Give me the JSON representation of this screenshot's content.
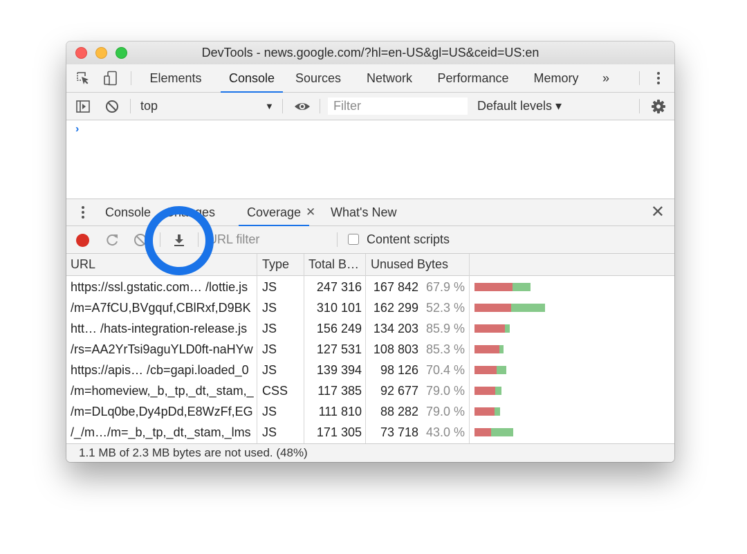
{
  "window": {
    "title": "DevTools - news.google.com/?hl=en-US&gl=US&ceid=US:en"
  },
  "main_tabs": [
    {
      "label": "Elements"
    },
    {
      "label": "Console",
      "active": true
    },
    {
      "label": "Sources"
    },
    {
      "label": "Network"
    },
    {
      "label": "Performance"
    },
    {
      "label": "Memory"
    }
  ],
  "main_tabs_overflow": "»",
  "console_toolbar": {
    "context": "top",
    "filter_placeholder": "Filter",
    "levels": "Default levels ▾"
  },
  "console": {
    "prompt": "›"
  },
  "drawer_tabs": [
    {
      "label": "Console"
    },
    {
      "label": "Changes"
    },
    {
      "label": "Coverage",
      "active": true,
      "closable": true
    },
    {
      "label": "What's New"
    }
  ],
  "coverage_toolbar": {
    "url_filter_placeholder": "URL filter",
    "content_scripts_label": "Content scripts",
    "content_scripts_checked": false,
    "export_button_highlighted": true
  },
  "coverage_table": {
    "columns": [
      "URL",
      "Type",
      "Total B…",
      "Unused Bytes"
    ],
    "rows": [
      {
        "url": "https://ssl.gstatic.com… /lottie.js",
        "type": "JS",
        "total": "247 316",
        "unused": "167 842",
        "pct": "67.9 %"
      },
      {
        "url": "/m=A7fCU,BVgquf,CBlRxf,D9BK",
        "type": "JS",
        "total": "310 101",
        "unused": "162 299",
        "pct": "52.3 %"
      },
      {
        "url": "htt… /hats-integration-release.js",
        "type": "JS",
        "total": "156 249",
        "unused": "134 203",
        "pct": "85.9 %"
      },
      {
        "url": "/rs=AA2YrTsi9aguYLD0ft-naHYw",
        "type": "JS",
        "total": "127 531",
        "unused": "108 803",
        "pct": "85.3 %"
      },
      {
        "url": "https://apis… /cb=gapi.loaded_0",
        "type": "JS",
        "total": "139 394",
        "unused": "98 126",
        "pct": "70.4 %"
      },
      {
        "url": "/m=homeview,_b,_tp,_dt,_stam,_",
        "type": "CSS",
        "total": "117 385",
        "unused": "92 677",
        "pct": "79.0 %"
      },
      {
        "url": "/m=DLq0be,Dy4pDd,E8WzFf,EG",
        "type": "JS",
        "total": "111 810",
        "unused": "88 282",
        "pct": "79.0 %"
      },
      {
        "url": "/_/m…/m=_b,_tp,_dt,_stam,_lms",
        "type": "JS",
        "total": "171 305",
        "unused": "73 718",
        "pct": "43.0 %"
      }
    ]
  },
  "footer": {
    "summary": "1.1 MB of 2.3 MB bytes are not used. (48%)"
  },
  "colors": {
    "accent": "#1a73e8",
    "unused_bar": "#d77070",
    "used_bar": "#86c98a",
    "record": "#d93025"
  }
}
